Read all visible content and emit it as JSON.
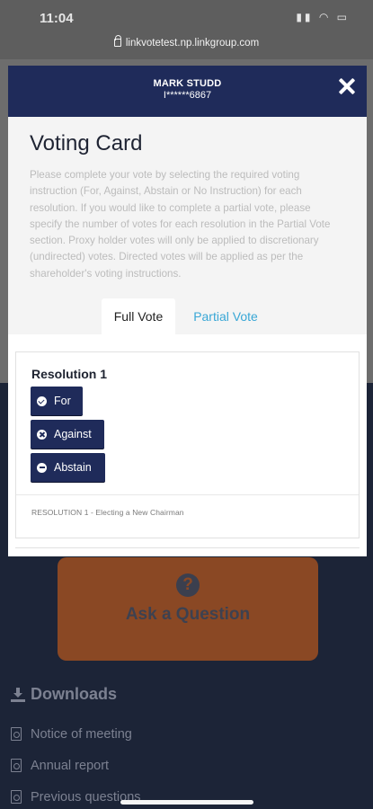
{
  "status_bar": {
    "time": "11:04"
  },
  "browser": {
    "url": "linkvotetest.np.linkgroup.com"
  },
  "modal": {
    "holder_name": "MARK STUDD",
    "holder_id": "I******6867",
    "title": "Voting Card",
    "instructions": "Please complete your vote by selecting the required voting instruction (For, Against, Abstain or No Instruction) for each resolution. If you would like to complete a partial vote, please specify the number of votes for each resolution in the Partial Vote section. Proxy holder votes will only be applied to discretionary (undirected) votes. Directed votes will be applied as per the shareholder's voting instructions.",
    "tabs": [
      {
        "label": "Full Vote",
        "active": true
      },
      {
        "label": "Partial Vote",
        "active": false
      }
    ],
    "resolution": {
      "title": "Resolution 1",
      "options": {
        "for": "For",
        "against": "Against",
        "abstain": "Abstain"
      },
      "description": "RESOLUTION 1 - Electing a New Chairman"
    }
  },
  "background": {
    "ask_question": "Ask a Question",
    "downloads_title": "Downloads",
    "documents": [
      "Notice of meeting",
      "Annual report",
      "Previous questions"
    ]
  },
  "colors": {
    "header": "#1f2b5a",
    "accent": "#39a7d6",
    "button": "#1f2b5a"
  }
}
